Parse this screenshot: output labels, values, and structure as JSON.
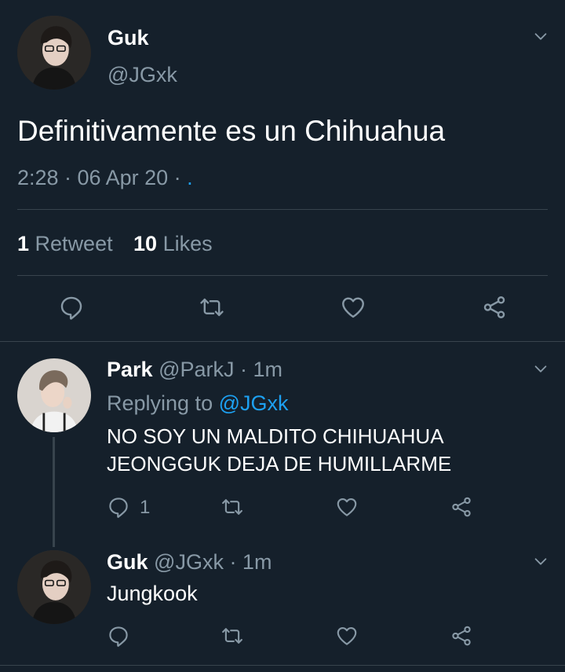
{
  "main_tweet": {
    "display_name": "Guk",
    "handle": "@JGxk",
    "text": "Definitivamente es un Chihuahua",
    "meta": "2:28 · 06 Apr 20 · ",
    "meta_dot": ".",
    "retweet_count": "1",
    "retweet_label": "Retweet",
    "like_count": "10",
    "like_label": "Likes"
  },
  "replies": [
    {
      "display_name": "Park",
      "handle_time": "@ParkJ · 1m",
      "replying_prefix": "Replying to ",
      "replying_handle": "@JGxk",
      "text_line1": "NO SOY UN MALDITO CHIHUAHUA",
      "text_line2": "JEONGGUK DEJA DE HUMILLARME",
      "reply_count": "1"
    },
    {
      "display_name": "Guk",
      "handle_time": "@JGxk · 1m",
      "text": "Jungkook"
    }
  ],
  "icons": {
    "reply": "reply-icon",
    "retweet": "retweet-icon",
    "like": "heart-icon",
    "share": "share-icon",
    "more": "chevron-down-icon"
  },
  "colors": {
    "background": "#15202b",
    "text": "#ffffff",
    "muted": "#8899a6",
    "link": "#1da1f2",
    "divider": "#38444d"
  }
}
